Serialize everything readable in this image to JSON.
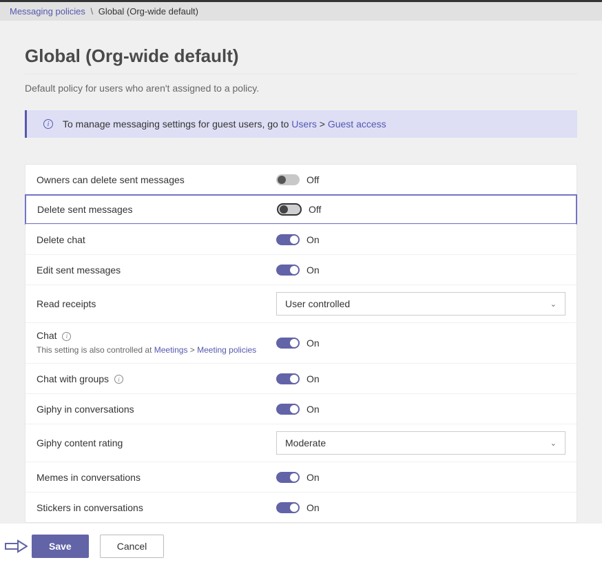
{
  "breadcrumb": {
    "parent": "Messaging policies",
    "sep": "\\",
    "current": "Global (Org-wide default)"
  },
  "header": {
    "title": "Global (Org-wide default)",
    "description": "Default policy for users who aren't assigned to a policy."
  },
  "banner": {
    "text_before": "To manage messaging settings for guest users, go to ",
    "link1": "Users",
    "sep": " > ",
    "link2": "Guest access"
  },
  "settings": {
    "owners_delete": {
      "label": "Owners can delete sent messages",
      "state": "Off"
    },
    "delete_sent": {
      "label": "Delete sent messages",
      "state": "Off"
    },
    "delete_chat": {
      "label": "Delete chat",
      "state": "On"
    },
    "edit_sent": {
      "label": "Edit sent messages",
      "state": "On"
    },
    "read_receipts": {
      "label": "Read receipts",
      "value": "User controlled"
    },
    "chat": {
      "label": "Chat ",
      "sub_before": "This setting is also controlled at ",
      "sub_link1": "Meetings",
      "sub_sep": " > ",
      "sub_link2": "Meeting policies",
      "state": "On"
    },
    "chat_groups": {
      "label": "Chat with groups ",
      "state": "On"
    },
    "giphy": {
      "label": "Giphy in conversations",
      "state": "On"
    },
    "giphy_rating": {
      "label": "Giphy content rating",
      "value": "Moderate"
    },
    "memes": {
      "label": "Memes in conversations",
      "state": "On"
    },
    "stickers": {
      "label": "Stickers in conversations",
      "state": "On"
    }
  },
  "footer": {
    "save": "Save",
    "cancel": "Cancel"
  }
}
